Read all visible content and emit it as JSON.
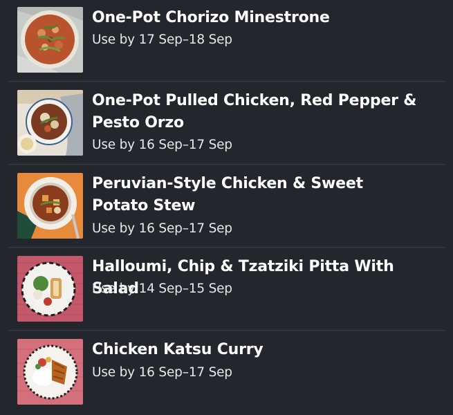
{
  "recipes": [
    {
      "title": "One-Pot Chorizo Minestrone",
      "use_by": "Use by 17 Sep–18 Sep",
      "image_icon": "chorizo-minestrone-photo"
    },
    {
      "title": "One-Pot Pulled Chicken, Red Pepper & Pesto Orzo",
      "use_by": "Use by 16 Sep–17 Sep",
      "image_icon": "pulled-chicken-orzo-photo"
    },
    {
      "title": "Peruvian-Style Chicken & Sweet Potato Stew",
      "use_by": "Use by 16 Sep–17 Sep",
      "image_icon": "peruvian-stew-photo"
    },
    {
      "title": "Halloumi, Chip & Tzatziki Pitta With Salad",
      "use_by": "Use by 14 Sep–15 Sep",
      "image_icon": "halloumi-pitta-photo"
    },
    {
      "title": "Chicken Katsu Curry",
      "use_by": "Use by 16 Sep–17 Sep",
      "image_icon": "katsu-curry-photo"
    }
  ],
  "colors": {
    "background": "#23272d",
    "divider": "#3a3f46",
    "title_text": "#ffffff",
    "date_text": "#e6e7e9"
  }
}
